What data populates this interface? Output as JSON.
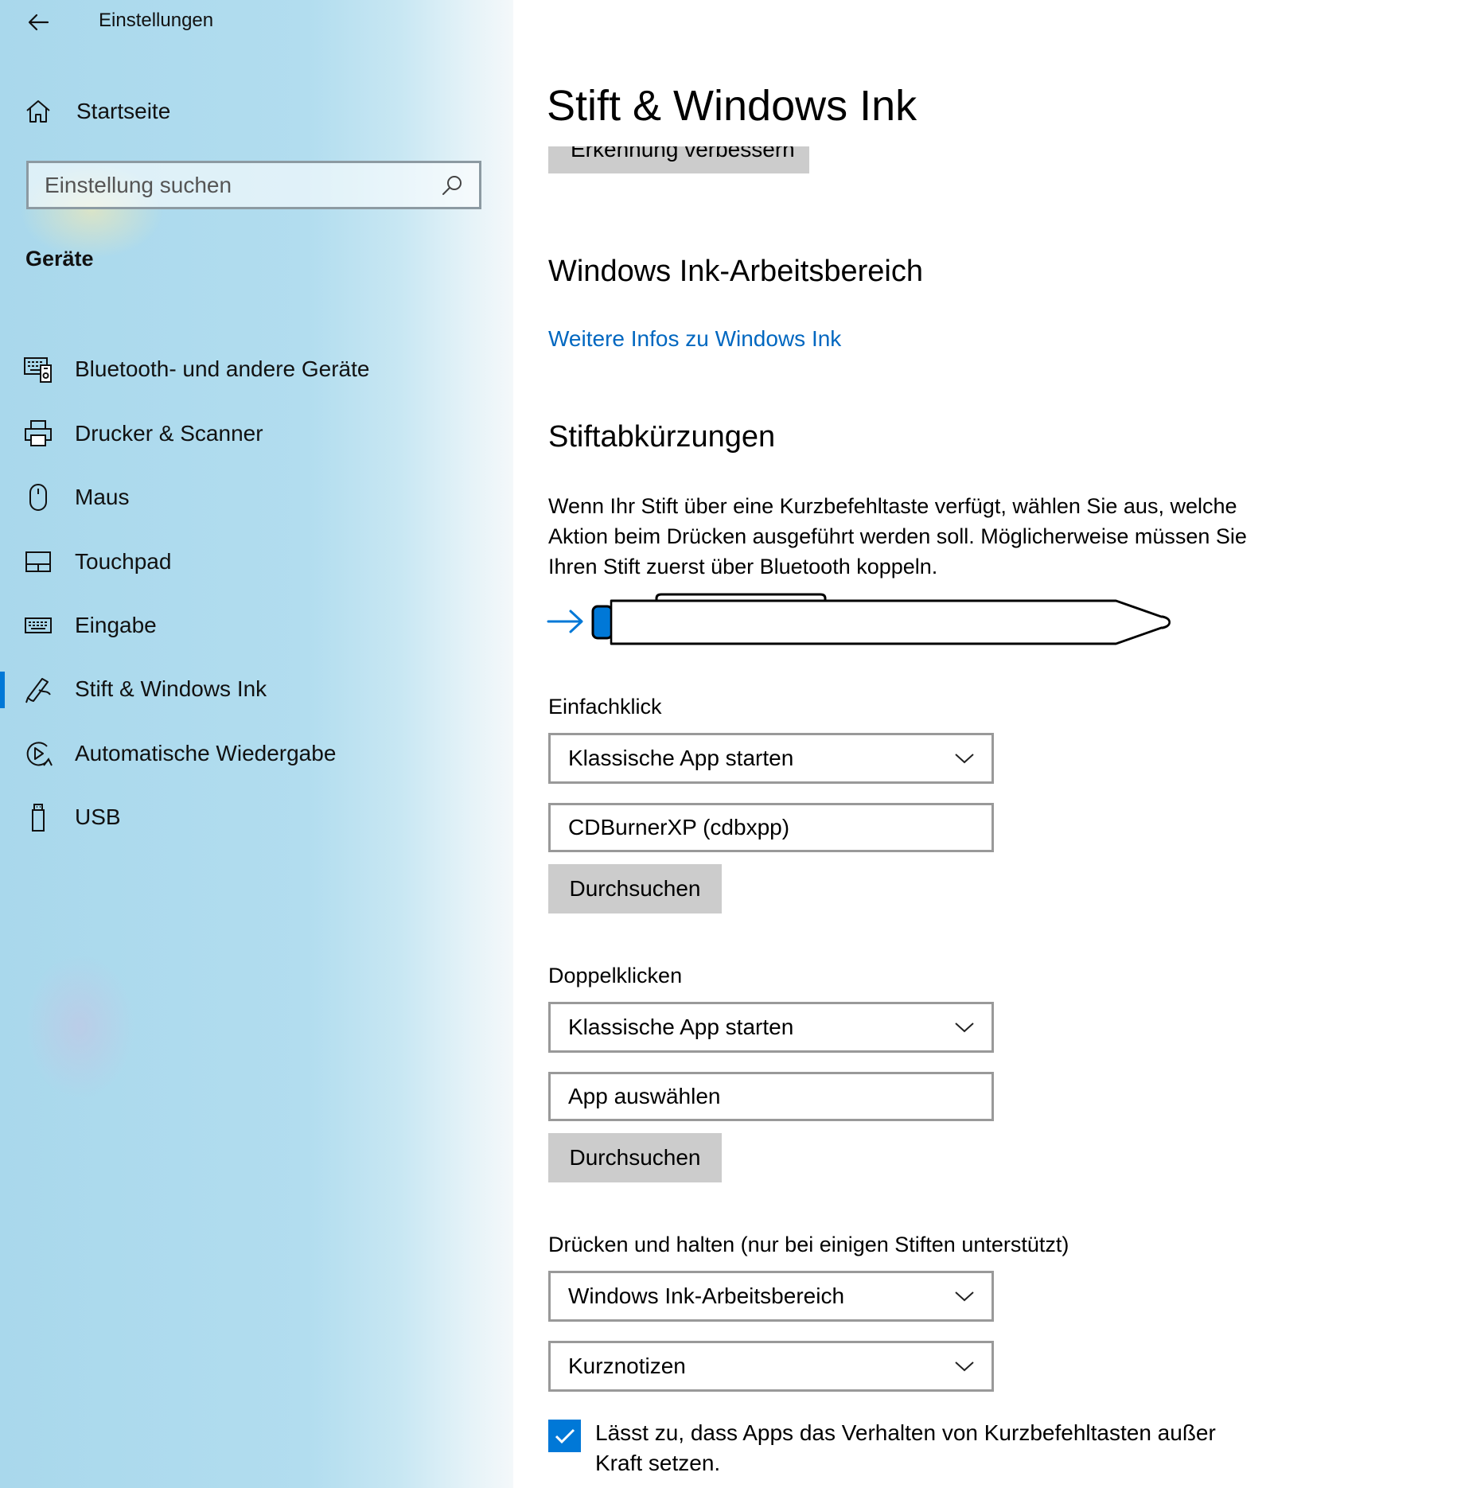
{
  "window": {
    "app_title": "Einstellungen"
  },
  "sidebar": {
    "home_label": "Startseite",
    "search_placeholder": "Einstellung suchen",
    "section_title": "Geräte",
    "items": [
      {
        "label": "Bluetooth- und andere Geräte",
        "icon": "bluetooth-devices-icon"
      },
      {
        "label": "Drucker & Scanner",
        "icon": "printer-icon"
      },
      {
        "label": "Maus",
        "icon": "mouse-icon"
      },
      {
        "label": "Touchpad",
        "icon": "touchpad-icon"
      },
      {
        "label": "Eingabe",
        "icon": "keyboard-icon"
      },
      {
        "label": "Stift & Windows Ink",
        "icon": "pen-icon",
        "selected": true
      },
      {
        "label": "Automatische Wiedergabe",
        "icon": "autoplay-icon"
      },
      {
        "label": "USB",
        "icon": "usb-icon"
      }
    ]
  },
  "main": {
    "page_title": "Stift & Windows Ink",
    "partial_button_label": "Erkennung verbessern",
    "ink_workspace": {
      "heading": "Windows Ink-Arbeitsbereich",
      "link": "Weitere Infos zu Windows Ink"
    },
    "shortcuts": {
      "heading": "Stiftabkürzungen",
      "description": "Wenn Ihr Stift über eine Kurzbefehltaste verfügt, wählen Sie aus, welche Aktion beim Drücken ausgeführt werden soll. Möglicherweise müssen Sie Ihren Stift zuerst über Bluetooth koppeln.",
      "single_click": {
        "label": "Einfachklick",
        "action": "Klassische App starten",
        "app": "CDBurnerXP (cdbxpp)",
        "browse": "Durchsuchen"
      },
      "double_click": {
        "label": "Doppelklicken",
        "action": "Klassische App starten",
        "app": "App auswählen",
        "browse": "Durchsuchen"
      },
      "press_hold": {
        "label": "Drücken und halten (nur bei einigen Stiften unterstützt)",
        "action": "Windows Ink-Arbeitsbereich",
        "app": "Kurznotizen"
      },
      "override_checkbox": {
        "label": "Lässt zu, dass Apps das Verhalten von Kurzbefehltasten außer Kraft setzen.",
        "checked": true
      }
    }
  },
  "colors": {
    "accent": "#0078d7",
    "link": "#0067c0",
    "button_gray": "#cccccc",
    "border_gray": "#999999"
  }
}
